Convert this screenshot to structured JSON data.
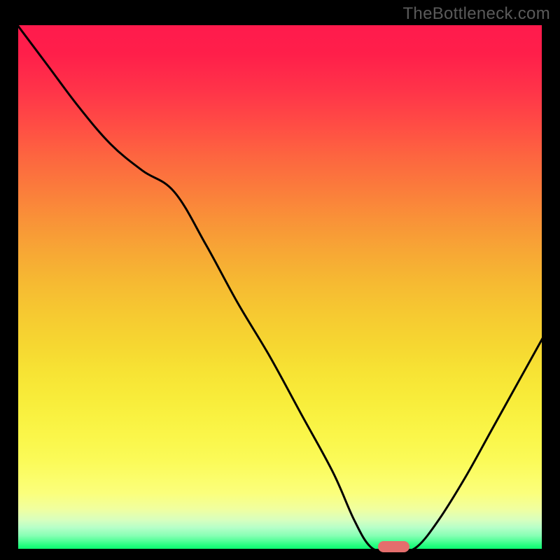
{
  "watermark": "TheBottleneck.com",
  "colors": {
    "frame_stroke": "#000000",
    "curve_stroke": "#000000",
    "marker_fill": "#e46e6d",
    "bg": "#000000"
  },
  "chart_data": {
    "type": "line",
    "title": "",
    "xlabel": "",
    "ylabel": "",
    "xlim": [
      0,
      100
    ],
    "ylim": [
      0,
      100
    ],
    "series": [
      {
        "name": "bottleneck-curve",
        "x": [
          0,
          6,
          12,
          18,
          24,
          30,
          36,
          42,
          48,
          54,
          60,
          64,
          67,
          70,
          73,
          76,
          80,
          85,
          90,
          95,
          100
        ],
        "values": [
          100,
          92,
          84,
          77,
          72,
          68,
          58,
          47,
          37,
          26,
          15,
          6,
          1,
          0,
          0,
          1,
          6,
          14,
          23,
          32,
          41
        ]
      }
    ],
    "marker": {
      "x_center": 71.5,
      "width_pct": 6.0,
      "y_pct": 0.9
    },
    "gradient_stops": [
      {
        "pct": 0,
        "hex": "#ff1a4d"
      },
      {
        "pct": 25,
        "hex": "#fd6440"
      },
      {
        "pct": 55,
        "hex": "#f6c931"
      },
      {
        "pct": 80,
        "hex": "#fafa50"
      },
      {
        "pct": 95,
        "hex": "#b5ffc8"
      },
      {
        "pct": 100,
        "hex": "#00f96a"
      }
    ]
  }
}
